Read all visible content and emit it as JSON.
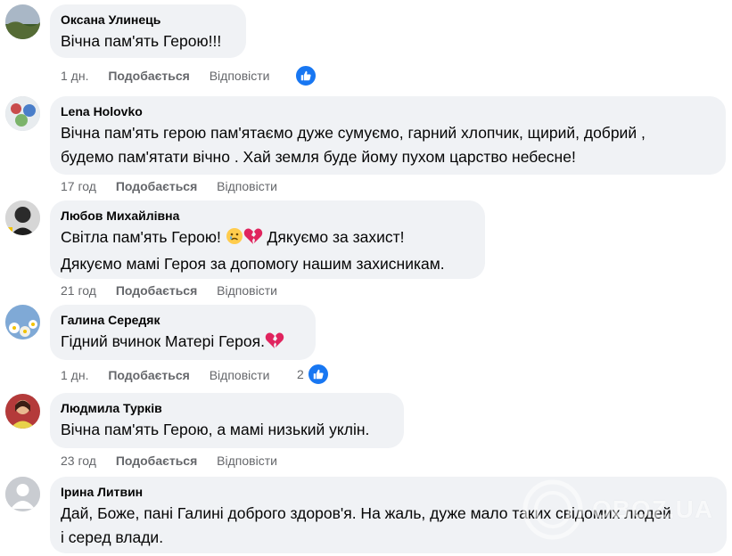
{
  "comments": [
    {
      "author": "Оксана Улинець",
      "lines": [
        "Вічна пам'ять Герою!!!"
      ],
      "time": "1 дн.",
      "like_label": "Подобається",
      "reply_label": "Відповісти",
      "reaction_count": ""
    },
    {
      "author": "Lena Holovko",
      "lines": [
        "Вічна пам'ять герою пам'ятаємо дуже сумуємо, гарний хлопчик, щирий, добрий ,",
        "будемо пам'ятати вічно . Хай земля буде йому пухом царство небесне!"
      ],
      "time": "17 год",
      "like_label": "Подобається",
      "reply_label": "Відповісти"
    },
    {
      "author": "Любов Михайлівна",
      "line1_before": "Світла пам'ять Герою! ",
      "line1_after": " Дякуємо за захист!",
      "line2": "Дякуємо мамі Героя за допомогу нашим захисникам.",
      "time": "21 год",
      "like_label": "Подобається",
      "reply_label": "Відповісти"
    },
    {
      "author": "Галина Середяк",
      "line1": "Гідний вчинок Матері Героя.",
      "time": "1 дн.",
      "like_label": "Подобається",
      "reply_label": "Відповісти",
      "reaction_count": "2"
    },
    {
      "author": "Людмила Турків",
      "lines": [
        "Вічна пам'ять Герою, а мамі низький уклін."
      ],
      "time": "23 год",
      "like_label": "Подобається",
      "reply_label": "Відповісти"
    },
    {
      "author": "Ірина Литвин",
      "lines": [
        "Дай, Боже, пані Галині доброго здоров'я. На жаль, дуже мало таких свідомих людей",
        "і серед влади."
      ]
    }
  ],
  "watermark": "OBOZ.UA",
  "colors": {
    "bubble": "#f0f2f5",
    "meta": "#65676b",
    "like_blue": "#1877f2",
    "broken_heart": "#e0245e",
    "sad_face": "#ffcc4d"
  }
}
